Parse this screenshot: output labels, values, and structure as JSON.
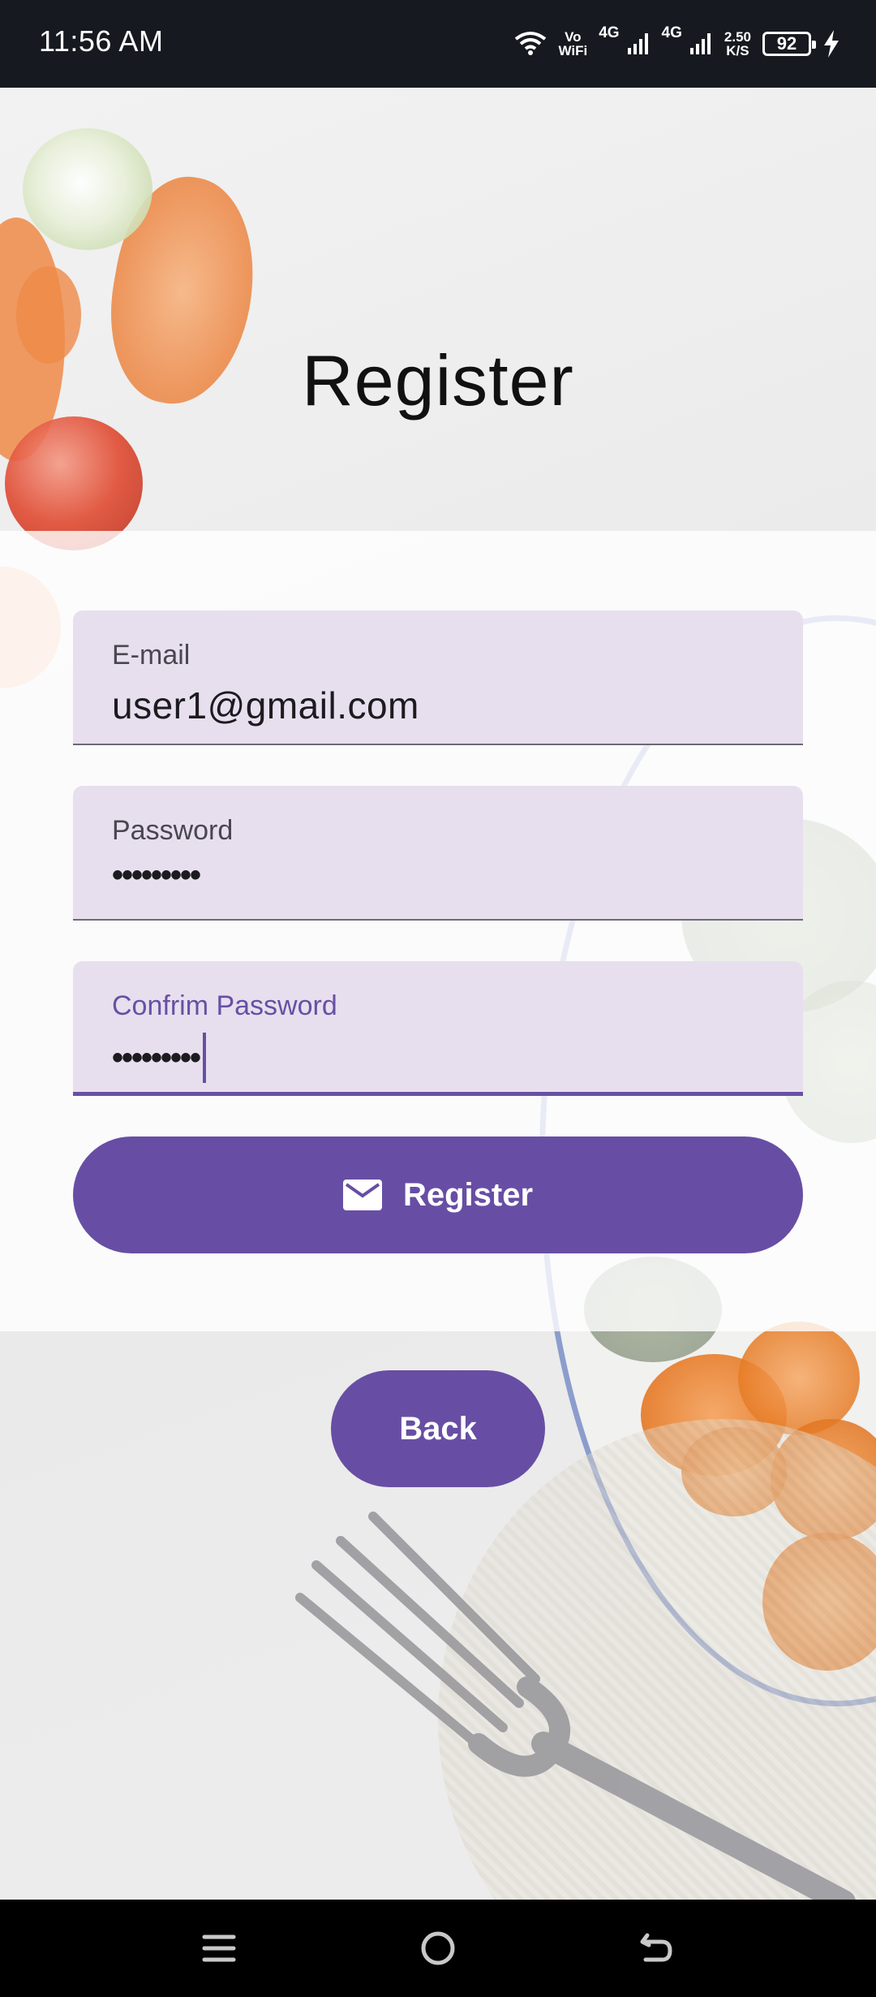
{
  "status_bar": {
    "time": "11:56 AM",
    "vowifi_top": "Vo",
    "vowifi_bottom": "WiFi",
    "sim1_label": "4G",
    "sim2_label": "4G",
    "speed_value": "2.50",
    "speed_unit": "K/S",
    "battery_level": "92"
  },
  "page": {
    "title": "Register"
  },
  "form": {
    "email": {
      "label": "E-mail",
      "value": "user1@gmail.com"
    },
    "password": {
      "label": "Password",
      "value": "•••••••••"
    },
    "confirm_password": {
      "label": "Confrim Password",
      "value": "•••••••••"
    },
    "register_button": "Register",
    "back_button": "Back"
  },
  "colors": {
    "accent": "#674ea4",
    "field_bg": "#e7dfee",
    "status_bar": "#161a20"
  },
  "icons": {
    "register": "mail-icon",
    "nav_recent": "menu-icon",
    "nav_home": "home-icon",
    "nav_back": "back-icon"
  }
}
